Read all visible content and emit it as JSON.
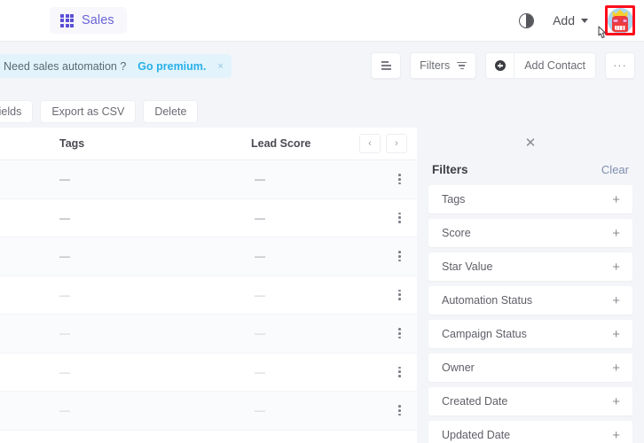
{
  "topbar": {
    "app_chip": {
      "icon": "app-grid-icon",
      "label": "Sales"
    },
    "contrast_toggle_icon": "contrast-toggle-icon",
    "add_button": {
      "label": "Add",
      "caret_icon": "chevron-down-icon"
    },
    "avatar": {
      "name": "user-avatar",
      "highlight_color": "#fc0d1b"
    }
  },
  "promo_banner": {
    "text": "Need sales automation ?",
    "link": "Go premium.",
    "close_label": "×",
    "bg_color": "#e2f3fb",
    "link_color": "#27b0e8"
  },
  "toolbar": {
    "list_view_icon": "list-view-icon",
    "filters": {
      "label": "Filters",
      "icon": "funnel-icon"
    },
    "add_contact": {
      "label": "Add Contact",
      "icon": "plus-circle-icon"
    },
    "more_label": "···"
  },
  "action_row": {
    "buttons": [
      {
        "label": "Fields"
      },
      {
        "label": "Export as CSV"
      },
      {
        "label": "Delete"
      }
    ]
  },
  "table": {
    "columns": [
      {
        "label": "Tags"
      },
      {
        "label": "Lead Score"
      }
    ],
    "pager": {
      "prev": "‹",
      "next": "›"
    },
    "empty_value": "—",
    "rows": [
      {
        "tags": "—",
        "lead_score": "—",
        "dash_color": "#8a8b92"
      },
      {
        "tags": "—",
        "lead_score": "—",
        "dash_color": "#8a8b92"
      },
      {
        "tags": "—",
        "lead_score": "—",
        "dash_color": "#9a9ba2"
      },
      {
        "tags": "—",
        "lead_score": "—",
        "dash_color": "#c6c7cd"
      },
      {
        "tags": "—",
        "lead_score": "—",
        "dash_color": "#cdced3"
      },
      {
        "tags": "—",
        "lead_score": "—",
        "dash_color": "#cdced3"
      },
      {
        "tags": "—",
        "lead_score": "—",
        "dash_color": "#cdced3"
      }
    ],
    "row_menu_icon": "more-vertical-icon"
  },
  "filters_panel": {
    "close_icon": "close-icon",
    "title": "Filters",
    "clear_label": "Clear",
    "items": [
      {
        "label": "Tags",
        "add_icon": "plus-icon"
      },
      {
        "label": "Score",
        "add_icon": "plus-icon"
      },
      {
        "label": "Star Value",
        "add_icon": "plus-icon"
      },
      {
        "label": "Automation Status",
        "add_icon": "plus-icon"
      },
      {
        "label": "Campaign Status",
        "add_icon": "plus-icon"
      },
      {
        "label": "Owner",
        "add_icon": "plus-icon"
      },
      {
        "label": "Created Date",
        "add_icon": "plus-icon"
      },
      {
        "label": "Updated Date",
        "add_icon": "plus-icon"
      }
    ]
  }
}
